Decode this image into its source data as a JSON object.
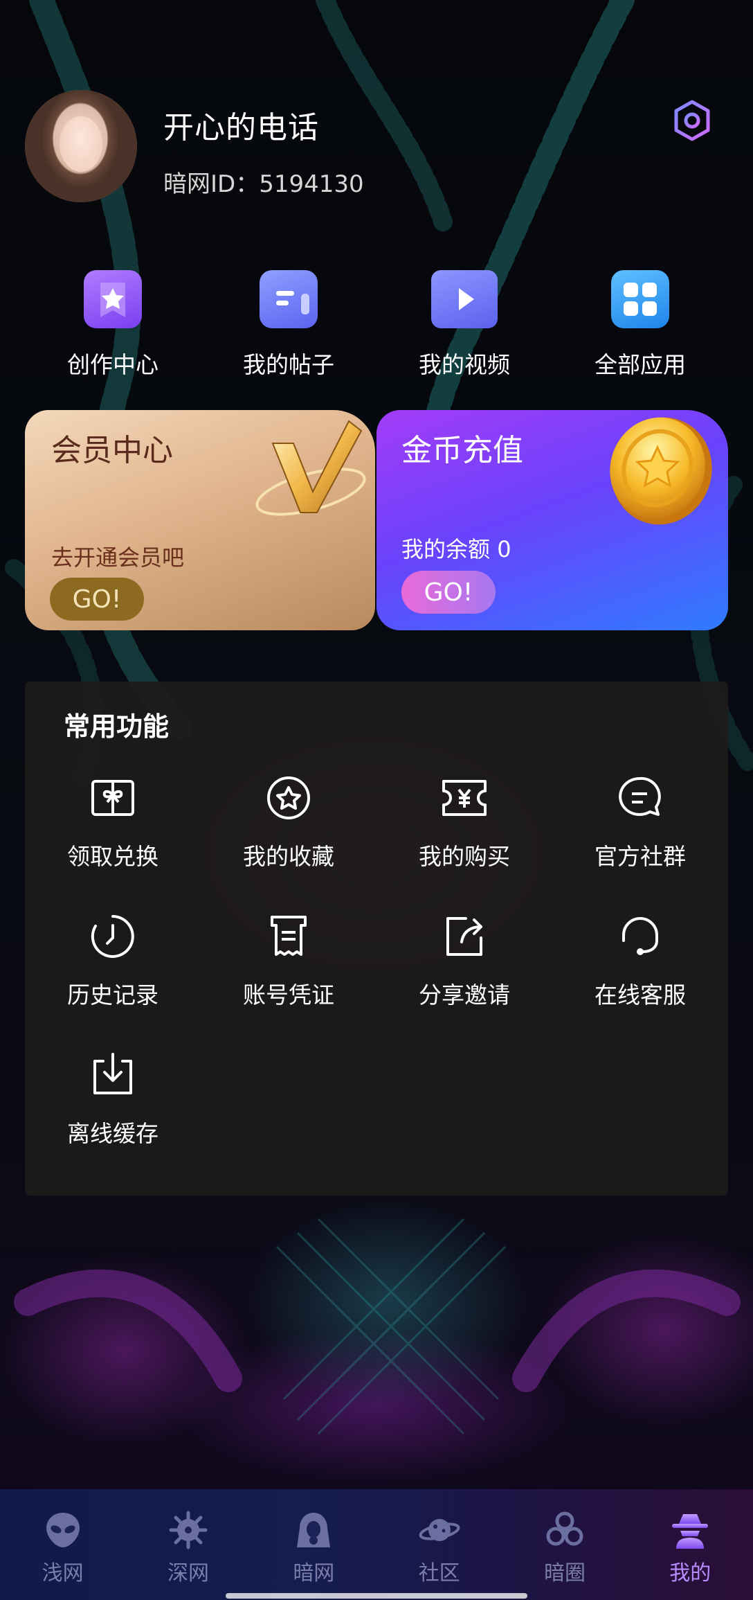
{
  "profile": {
    "username": "开心的电话",
    "id_label": "暗网ID：",
    "id_value": "5194130"
  },
  "quick_entries": [
    {
      "label": "创作中心",
      "icon": "star-bookmark-icon",
      "color": "#8b5cf6"
    },
    {
      "label": "我的帖子",
      "icon": "post-icon",
      "color": "#6b7bf5"
    },
    {
      "label": "我的视频",
      "icon": "video-play-icon",
      "color": "#6a6ff4"
    },
    {
      "label": "全部应用",
      "icon": "apps-grid-icon",
      "color": "#2b9df2"
    }
  ],
  "vip_card": {
    "title": "会员中心",
    "subtitle": "去开通会员吧",
    "button": "GO!"
  },
  "coin_card": {
    "title": "金币充值",
    "balance_label": "我的余额",
    "balance_value": "0",
    "button": "GO!"
  },
  "common": {
    "title": "常用功能",
    "items": [
      {
        "label": "领取兑换",
        "icon": "gift-card-icon"
      },
      {
        "label": "我的收藏",
        "icon": "star-circle-icon"
      },
      {
        "label": "我的购买",
        "icon": "ticket-yen-icon"
      },
      {
        "label": "官方社群",
        "icon": "chat-bubble-icon"
      },
      {
        "label": "历史记录",
        "icon": "clock-icon"
      },
      {
        "label": "账号凭证",
        "icon": "receipt-icon"
      },
      {
        "label": "分享邀请",
        "icon": "share-icon"
      },
      {
        "label": "在线客服",
        "icon": "headset-icon"
      },
      {
        "label": "离线缓存",
        "icon": "download-icon"
      }
    ]
  },
  "bottom_nav": [
    {
      "label": "浅网",
      "icon": "alien-icon",
      "active": false
    },
    {
      "label": "深网",
      "icon": "mine-icon",
      "active": false
    },
    {
      "label": "暗网",
      "icon": "hooded-figure-icon",
      "active": false
    },
    {
      "label": "社区",
      "icon": "planet-icon",
      "active": false
    },
    {
      "label": "暗圈",
      "icon": "biohazard-icon",
      "active": false
    },
    {
      "label": "我的",
      "icon": "spy-icon",
      "active": true
    }
  ],
  "colors": {
    "active_tab": "#b88cff",
    "inactive_tab": "#7a7ea8",
    "vip_go": "#8d6a21",
    "settings_gradient": [
      "#7b8cff",
      "#d06bff"
    ]
  }
}
